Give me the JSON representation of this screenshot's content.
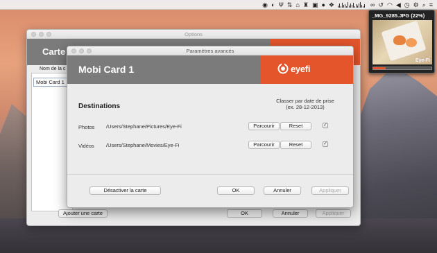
{
  "menubar": {
    "icons": [
      "rss-icon",
      "backup-icon",
      "network-icon",
      "arrows-icon",
      "home-icon",
      "hat-icon",
      "display-icon",
      "media-icon",
      "dropbox-icon",
      "activity-graph",
      "link-icon",
      "time-machine-icon",
      "wifi-icon",
      "volume-icon",
      "clock-icon",
      "gear-icon",
      "search-icon",
      "list-icon"
    ]
  },
  "preview": {
    "title": "_MG_9285.JPG (22%)",
    "brand": "Eye-Fi",
    "progress": 0.22
  },
  "options_window": {
    "title": "Options",
    "header_title": "Carte",
    "column_header": "Nom de la c",
    "cards": [
      "Mobi Card 1"
    ],
    "buttons": {
      "add_card": "Ajouter une carte",
      "ok": "OK",
      "cancel": "Annuler",
      "apply": "Appliquer"
    }
  },
  "advanced_dialog": {
    "title": "Paramètres avancés",
    "card_name": "Mobi Card 1",
    "logo_text": "eyefi",
    "section_title": "Destinations",
    "sort_label_line1": "Classer par date de prise",
    "sort_label_line2": "(ex. 28-12-2013)",
    "rows": [
      {
        "label": "Photos",
        "path": "/Users/Stephane/Pictures/Eye-Fi",
        "browse": "Parcourir",
        "reset": "Reset",
        "checked": true
      },
      {
        "label": "Vidéos",
        "path": "/Users/Stephane/Movies/Eye-Fi",
        "browse": "Parcourir",
        "reset": "Reset",
        "checked": true
      }
    ],
    "buttons": {
      "disable_card": "Désactiver la carte",
      "ok": "OK",
      "cancel": "Annuler",
      "apply": "Appliquer"
    }
  },
  "colors": {
    "brand_orange": "#e4552c",
    "header_gray": "#7b7b7b",
    "window_bg": "#ececec"
  }
}
